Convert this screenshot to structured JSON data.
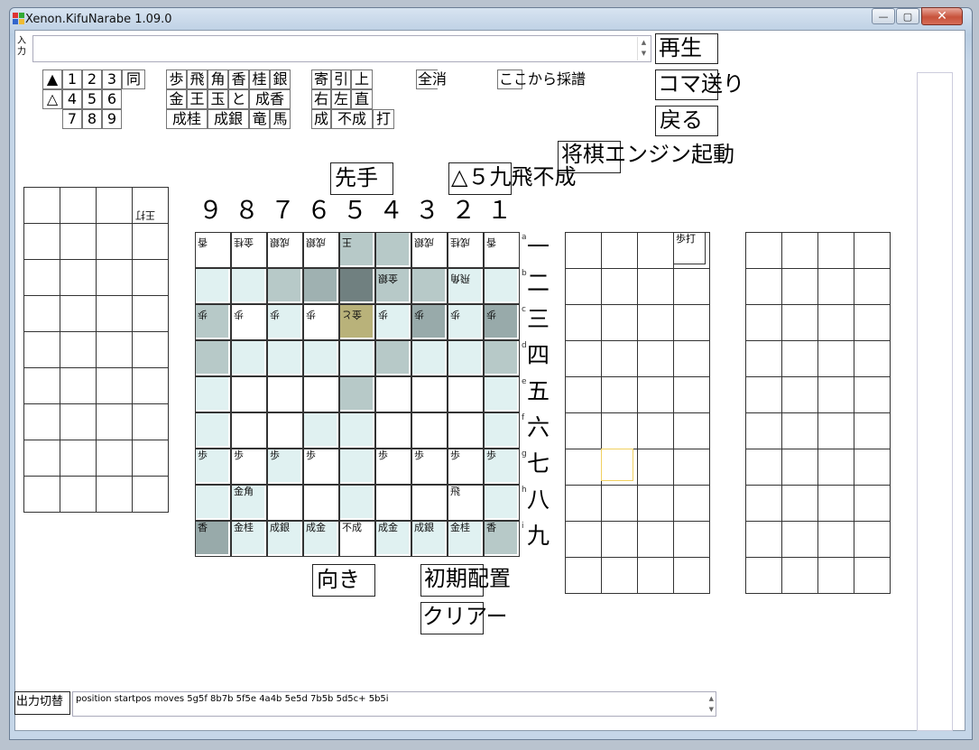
{
  "window": {
    "title": "Xenon.KifuNarabe 1.09.0",
    "min_label": "—",
    "max_label": "▢",
    "close_label": "✕"
  },
  "input_label": "入力",
  "toolbar": {
    "play": "再生",
    "step": "コマ送り",
    "back": "戻る",
    "engine": "将棋エンジン起動"
  },
  "keypad": {
    "turn": [
      "▲",
      "△"
    ],
    "nums": [
      "1",
      "2",
      "3",
      "同",
      "4",
      "5",
      "6",
      "7",
      "8",
      "9"
    ],
    "pieces": [
      "歩",
      "飛",
      "角",
      "香",
      "桂",
      "銀",
      "金",
      "王",
      "玉",
      "と",
      "成香",
      "成桂",
      "成銀",
      "竜",
      "馬"
    ],
    "moves": [
      "寄",
      "引",
      "上",
      "右",
      "左",
      "直",
      "成",
      "不成",
      "打"
    ],
    "clear_all": "全消",
    "record_from_here": "ここから採譜"
  },
  "turn_label": "先手",
  "last_move": "△５九飛不成",
  "files": [
    "９",
    "８",
    "７",
    "６",
    "５",
    "４",
    "３",
    "２",
    "１"
  ],
  "ranks": [
    "一",
    "二",
    "三",
    "四",
    "五",
    "六",
    "七",
    "八",
    "九"
  ],
  "rank_letters": [
    "a",
    "b",
    "c",
    "d",
    "e",
    "f",
    "g",
    "h",
    "i"
  ],
  "board": {
    "r1": [
      "香",
      "金桂",
      "成銀",
      "成銀",
      "王",
      "",
      "成銀",
      "成桂",
      "香"
    ],
    "r2": [
      "",
      "",
      "",
      "",
      "",
      "金銀",
      "",
      "飛角",
      ""
    ],
    "r3": [
      "歩",
      "歩",
      "歩",
      "歩",
      "金と",
      "歩",
      "歩",
      "歩",
      "歩"
    ],
    "r7": [
      "歩",
      "歩",
      "歩",
      "歩",
      "",
      "歩",
      "歩",
      "歩",
      "歩"
    ],
    "r8": [
      "",
      "金角",
      "",
      "",
      "",
      "",
      "",
      "飛",
      ""
    ],
    "r9": [
      "香",
      "金桂",
      "成銀",
      "成金",
      "不成",
      "成金",
      "成銀",
      "金桂",
      "香"
    ]
  },
  "left_box_piece": "王打",
  "right_box_piece": "歩打",
  "buttons": {
    "direction": "向き",
    "initial": "初期配置",
    "clear": "クリアー",
    "output_switch": "出力切替"
  },
  "output_text": "position startpos moves 5g5f 8b7b 5f5e 4a4b 5e5d 7b5b 5d5c+ 5b5i"
}
